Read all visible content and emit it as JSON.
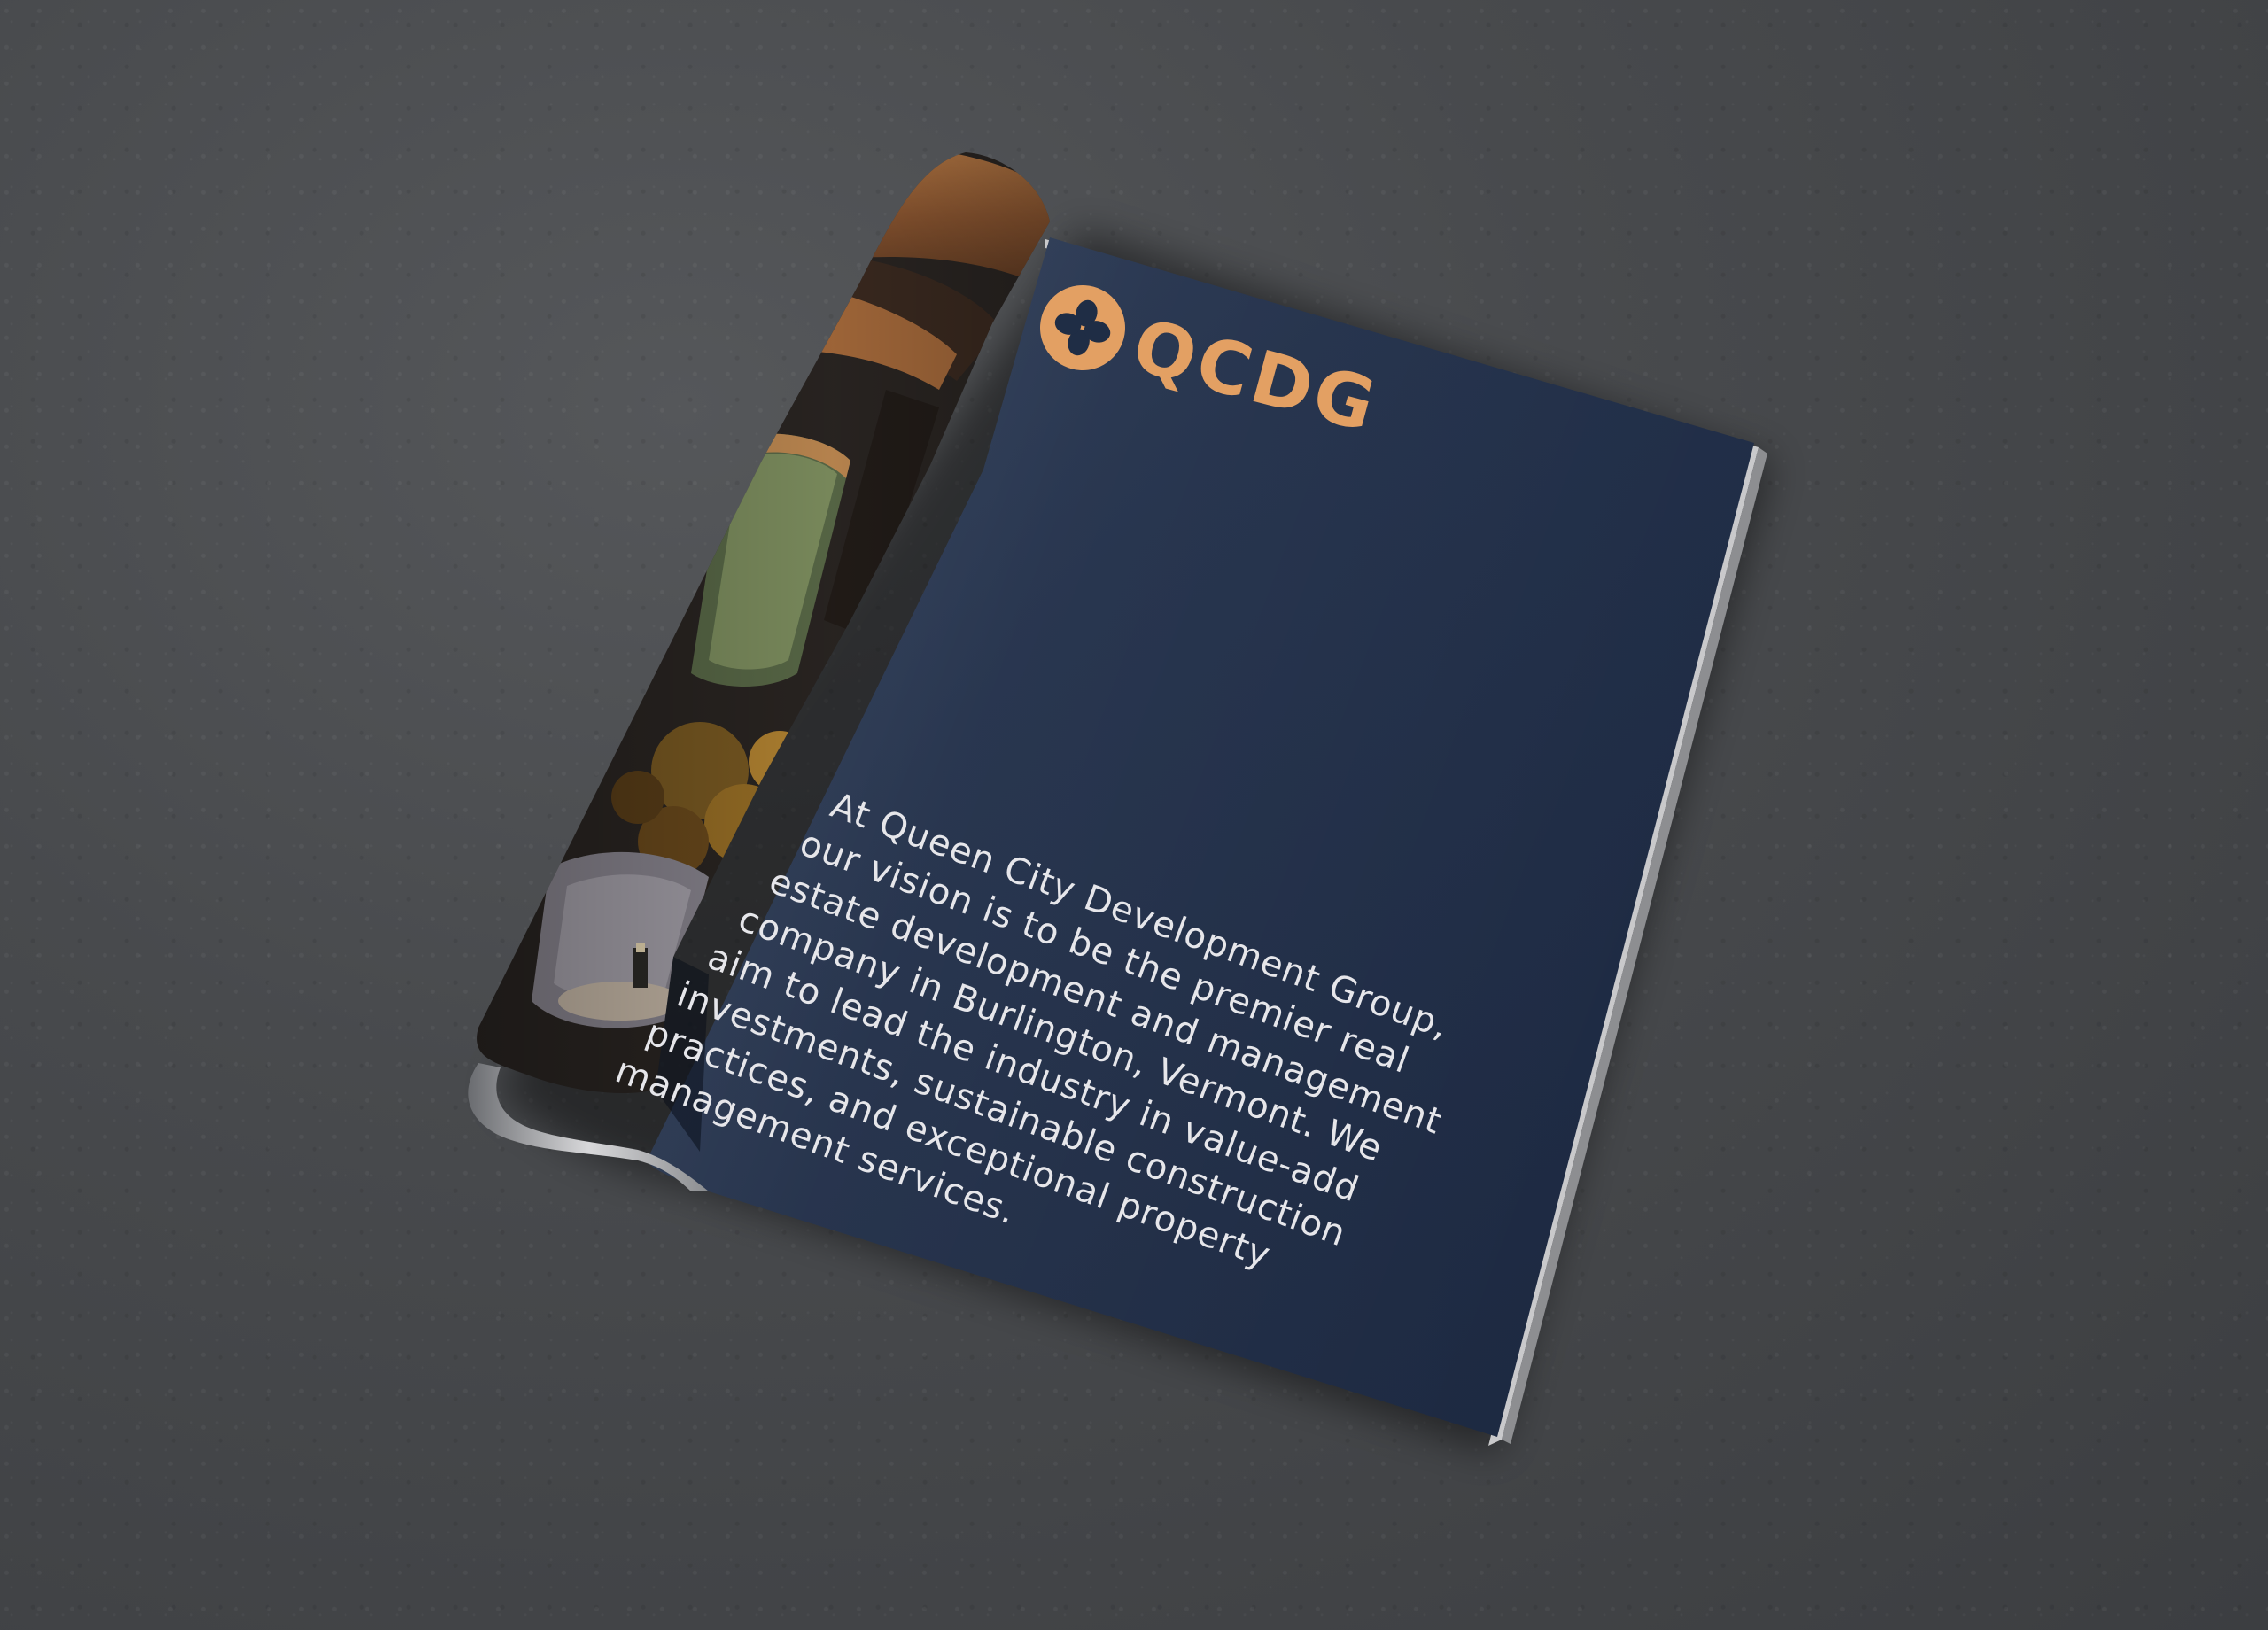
{
  "brand": {
    "wordmark": "QCDG",
    "accent_color": "#e3a063",
    "logo_icon": "four-petal-clover-icon"
  },
  "page": {
    "background_color": "#1f2d45",
    "paragraph_lines": [
      "At Queen City Development Group,",
      "our vision is to be the premier real",
      "estate development and management",
      "company in Burlington, Vermont. We",
      "aim to lead the industry in value-add",
      "investments, sustainable construction",
      "practices, and exceptional property",
      "management services."
    ]
  },
  "photo": {
    "subject": "interior-photo"
  }
}
